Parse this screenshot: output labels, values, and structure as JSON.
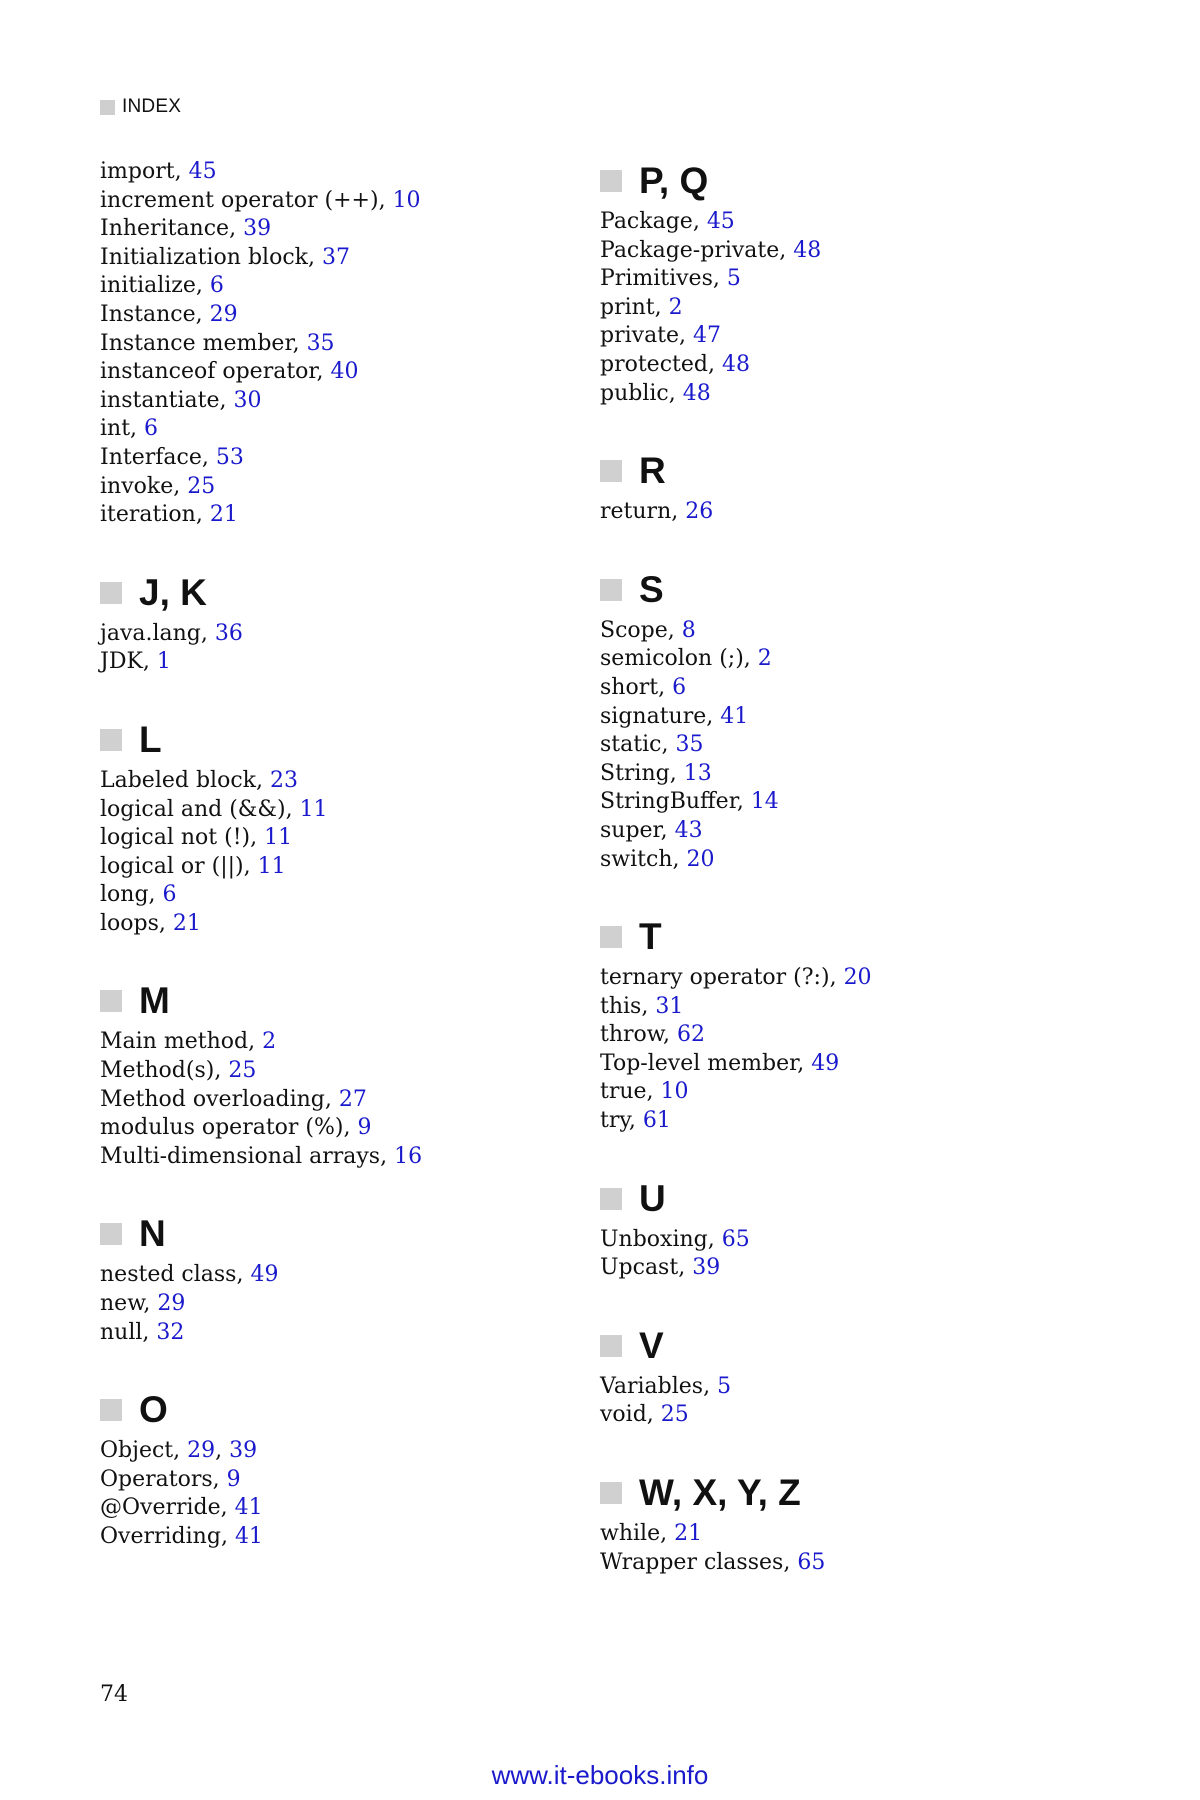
{
  "header": {
    "label": "INDEX"
  },
  "left_column": [
    {
      "heading": "",
      "entries": [
        {
          "term": "import",
          "pages": [
            "45"
          ]
        },
        {
          "term": "increment operator (++)",
          "pages": [
            "10"
          ]
        },
        {
          "term": "Inheritance",
          "pages": [
            "39"
          ]
        },
        {
          "term": "Initialization block",
          "pages": [
            "37"
          ]
        },
        {
          "term": "initialize",
          "pages": [
            "6"
          ]
        },
        {
          "term": "Instance",
          "pages": [
            "29"
          ]
        },
        {
          "term": "Instance member",
          "pages": [
            "35"
          ]
        },
        {
          "term": "instanceof operator",
          "pages": [
            "40"
          ]
        },
        {
          "term": "instantiate",
          "pages": [
            "30"
          ]
        },
        {
          "term": "int",
          "pages": [
            "6"
          ]
        },
        {
          "term": "Interface",
          "pages": [
            "53"
          ]
        },
        {
          "term": "invoke",
          "pages": [
            "25"
          ]
        },
        {
          "term": "iteration",
          "pages": [
            "21"
          ]
        }
      ]
    },
    {
      "heading": "J, K",
      "entries": [
        {
          "term": "java.lang",
          "pages": [
            "36"
          ]
        },
        {
          "term": "JDK",
          "pages": [
            "1"
          ]
        }
      ]
    },
    {
      "heading": "L",
      "entries": [
        {
          "term": "Labeled block",
          "pages": [
            "23"
          ]
        },
        {
          "term": "logical and (&&)",
          "pages": [
            "11"
          ]
        },
        {
          "term": "logical not (!)",
          "pages": [
            "11"
          ]
        },
        {
          "term": "logical or (||)",
          "pages": [
            "11"
          ]
        },
        {
          "term": "long",
          "pages": [
            "6"
          ]
        },
        {
          "term": "loops",
          "pages": [
            "21"
          ]
        }
      ]
    },
    {
      "heading": "M",
      "entries": [
        {
          "term": "Main method",
          "pages": [
            "2"
          ]
        },
        {
          "term": "Method(s)",
          "pages": [
            "25"
          ]
        },
        {
          "term": "Method overloading",
          "pages": [
            "27"
          ]
        },
        {
          "term": "modulus operator (%)",
          "pages": [
            "9"
          ]
        },
        {
          "term": "Multi-dimensional arrays",
          "pages": [
            "16"
          ]
        }
      ]
    },
    {
      "heading": "N",
      "entries": [
        {
          "term": "nested class",
          "pages": [
            "49"
          ]
        },
        {
          "term": "new",
          "pages": [
            "29"
          ]
        },
        {
          "term": "null",
          "pages": [
            "32"
          ]
        }
      ]
    },
    {
      "heading": "O",
      "entries": [
        {
          "term": "Object",
          "pages": [
            "29",
            "39"
          ]
        },
        {
          "term": "Operators",
          "pages": [
            "9"
          ]
        },
        {
          "term": "@Override",
          "pages": [
            "41"
          ]
        },
        {
          "term": "Overriding",
          "pages": [
            "41"
          ]
        }
      ]
    }
  ],
  "right_column": [
    {
      "heading": "P, Q",
      "entries": [
        {
          "term": "Package",
          "pages": [
            "45"
          ]
        },
        {
          "term": "Package-private",
          "pages": [
            "48"
          ]
        },
        {
          "term": "Primitives",
          "pages": [
            "5"
          ]
        },
        {
          "term": "print",
          "pages": [
            "2"
          ]
        },
        {
          "term": "private",
          "pages": [
            "47"
          ]
        },
        {
          "term": "protected",
          "pages": [
            "48"
          ]
        },
        {
          "term": "public",
          "pages": [
            "48"
          ]
        }
      ]
    },
    {
      "heading": "R",
      "entries": [
        {
          "term": "return",
          "pages": [
            "26"
          ]
        }
      ]
    },
    {
      "heading": "S",
      "entries": [
        {
          "term": "Scope",
          "pages": [
            "8"
          ]
        },
        {
          "term": "semicolon (;)",
          "pages": [
            "2"
          ]
        },
        {
          "term": "short",
          "pages": [
            "6"
          ]
        },
        {
          "term": "signature",
          "pages": [
            "41"
          ]
        },
        {
          "term": "static",
          "pages": [
            "35"
          ]
        },
        {
          "term": "String",
          "pages": [
            "13"
          ]
        },
        {
          "term": "StringBuffer",
          "pages": [
            "14"
          ]
        },
        {
          "term": "super",
          "pages": [
            "43"
          ]
        },
        {
          "term": "switch",
          "pages": [
            "20"
          ]
        }
      ]
    },
    {
      "heading": "T",
      "entries": [
        {
          "term": "ternary operator (?:)",
          "pages": [
            "20"
          ]
        },
        {
          "term": "this",
          "pages": [
            "31"
          ]
        },
        {
          "term": "throw",
          "pages": [
            "62"
          ]
        },
        {
          "term": "Top-level member",
          "pages": [
            "49"
          ]
        },
        {
          "term": "true",
          "pages": [
            "10"
          ]
        },
        {
          "term": "try",
          "pages": [
            "61"
          ]
        }
      ]
    },
    {
      "heading": "U",
      "entries": [
        {
          "term": "Unboxing",
          "pages": [
            "65"
          ]
        },
        {
          "term": "Upcast",
          "pages": [
            "39"
          ]
        }
      ]
    },
    {
      "heading": "V",
      "entries": [
        {
          "term": "Variables",
          "pages": [
            "5"
          ]
        },
        {
          "term": "void",
          "pages": [
            "25"
          ]
        }
      ]
    },
    {
      "heading": "W, X, Y, Z",
      "entries": [
        {
          "term": "while",
          "pages": [
            "21"
          ]
        },
        {
          "term": "Wrapper classes",
          "pages": [
            "65"
          ]
        }
      ]
    }
  ],
  "footer": {
    "page_number": "74",
    "website": "www.it-ebooks.info"
  },
  "colors": {
    "link": "#1a1acc",
    "heading_square": "#d0d0d0"
  }
}
